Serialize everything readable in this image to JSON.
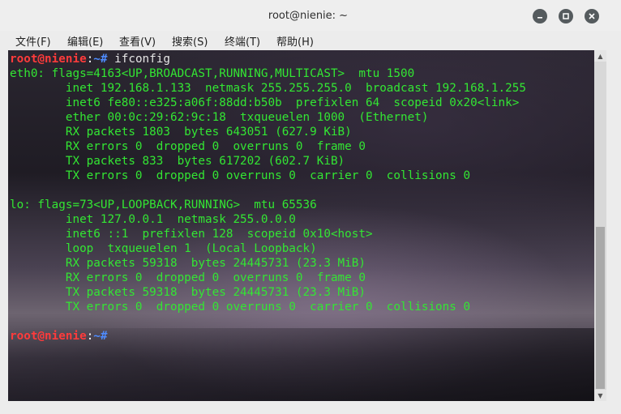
{
  "window": {
    "title": "root@nienie: ~",
    "controls": {
      "minimize_icon": "minimize-icon",
      "maximize_icon": "maximize-icon",
      "close_icon": "close-icon"
    }
  },
  "menubar": {
    "items": [
      "文件(F)",
      "编辑(E)",
      "查看(V)",
      "搜索(S)",
      "终端(T)",
      "帮助(H)"
    ]
  },
  "terminal": {
    "prompt_user_host": "root@nienie",
    "prompt_sep": ":",
    "prompt_path": "~#",
    "command": " ifconfig",
    "output": [
      "eth0: flags=4163<UP,BROADCAST,RUNNING,MULTICAST>  mtu 1500",
      "        inet 192.168.1.133  netmask 255.255.255.0  broadcast 192.168.1.255",
      "        inet6 fe80::e325:a06f:88dd:b50b  prefixlen 64  scopeid 0x20<link>",
      "        ether 00:0c:29:62:9c:18  txqueuelen 1000  (Ethernet)",
      "        RX packets 1803  bytes 643051 (627.9 KiB)",
      "        RX errors 0  dropped 0  overruns 0  frame 0",
      "        TX packets 833  bytes 617202 (602.7 KiB)",
      "        TX errors 0  dropped 0 overruns 0  carrier 0  collisions 0",
      "",
      "lo: flags=73<UP,LOOPBACK,RUNNING>  mtu 65536",
      "        inet 127.0.0.1  netmask 255.0.0.0",
      "        inet6 ::1  prefixlen 128  scopeid 0x10<host>",
      "        loop  txqueuelen 1  (Local Loopback)",
      "        RX packets 59318  bytes 24445731 (23.3 MiB)",
      "        RX errors 0  dropped 0  overruns 0  frame 0",
      "        TX packets 59318  bytes 24445731 (23.3 MiB)",
      "        TX errors 0  dropped 0 overruns 0  carrier 0  collisions 0",
      ""
    ],
    "final_prompt_command": "",
    "colors": {
      "text": "#33e633",
      "user": "#ff3b3b",
      "path": "#4e8cff"
    }
  }
}
